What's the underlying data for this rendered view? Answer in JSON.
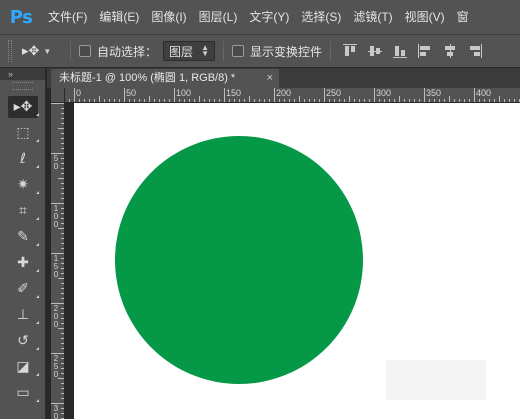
{
  "app": {
    "logo": "Ps",
    "menu": [
      "文件(F)",
      "编辑(E)",
      "图像(I)",
      "图层(L)",
      "文字(Y)",
      "选择(S)",
      "滤镜(T)",
      "视图(V)",
      "窗"
    ]
  },
  "options": {
    "auto_select_label": "自动选择：",
    "auto_select_checked": false,
    "auto_select_target": "图层",
    "show_transform_label": "显示变换控件",
    "show_transform_checked": false
  },
  "tools": [
    {
      "name": "move-tool",
      "icon": "move-icon",
      "glyph": "▸✥",
      "active": true
    },
    {
      "name": "marquee-tool",
      "icon": "rect-marquee-icon",
      "glyph": "⬚"
    },
    {
      "name": "lasso-tool",
      "icon": "lasso-icon",
      "glyph": "ℓ"
    },
    {
      "name": "magic-wand-tool",
      "icon": "magic-wand-icon",
      "glyph": "✷"
    },
    {
      "name": "crop-tool",
      "icon": "crop-icon",
      "glyph": "⌗"
    },
    {
      "name": "eyedropper-tool",
      "icon": "eyedropper-icon",
      "glyph": "✎"
    },
    {
      "name": "healing-brush-tool",
      "icon": "bandage-icon",
      "glyph": "✚"
    },
    {
      "name": "brush-tool",
      "icon": "brush-icon",
      "glyph": "✐"
    },
    {
      "name": "clone-stamp-tool",
      "icon": "stamp-icon",
      "glyph": "⊥"
    },
    {
      "name": "history-brush-tool",
      "icon": "history-brush-icon",
      "glyph": "↺"
    },
    {
      "name": "eraser-tool",
      "icon": "eraser-icon",
      "glyph": "◪"
    },
    {
      "name": "gradient-tool",
      "icon": "gradient-icon",
      "glyph": "▭"
    }
  ],
  "document": {
    "tab_title": "未标题-1 @ 100% (椭圆 1, RGB/8) *",
    "close_glyph": "×",
    "ruler_h_labels": [
      "0",
      "50",
      "100",
      "150",
      "200",
      "250",
      "300",
      "350",
      "400"
    ],
    "ruler_v_labels": [
      "5 0",
      "1 0 0",
      "1 5 0",
      "2 0 0",
      "2 5 0",
      "3 0 0"
    ],
    "canvas_color": "#ffffff",
    "ellipse_color": "#059947"
  },
  "colors": {
    "ps_blue": "#31a8ff",
    "panel": "#535353",
    "background": "#282828"
  }
}
